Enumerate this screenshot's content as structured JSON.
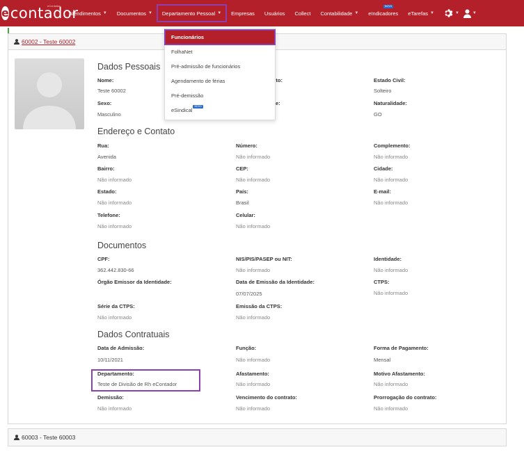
{
  "brand": {
    "name": "contador",
    "tag": "eContador"
  },
  "nav": {
    "items": [
      {
        "label": "Atendimentos",
        "dropdown": true
      },
      {
        "label": "Documentos",
        "dropdown": true
      },
      {
        "label": "Departamento Pessoal",
        "dropdown": true
      },
      {
        "label": "Empresas",
        "dropdown": false
      },
      {
        "label": "Usuários",
        "dropdown": false
      },
      {
        "label": "Collect",
        "dropdown": false
      },
      {
        "label": "Contabilidade",
        "dropdown": true
      },
      {
        "label": "eIndicadores",
        "dropdown": false
      },
      {
        "label": "eTarefas",
        "dropdown": true
      }
    ],
    "new_badge": "NOVO"
  },
  "dropdown": {
    "items": [
      "Funcionários",
      "FolhaNet",
      "Pré-admissão de funcionários",
      "Agendamento de férias",
      "Pré-demissão",
      "eSindical"
    ],
    "badge": "NOVO"
  },
  "employee": {
    "header": "60002 - Teste 60002",
    "sections": {
      "personal": "Dados Pessoais",
      "address": "Endereço e Contato",
      "documents": "Documentos",
      "contract": "Dados Contratuais"
    },
    "fields": {
      "nome_label": "Nome:",
      "nome": "Teste 60002",
      "nascimento_label": "mento:",
      "estado_civil_label": "Estado Civil:",
      "estado_civil": "Solteiro",
      "sexo_label": "Sexo:",
      "sexo": "Masculino",
      "e_label": "e:",
      "naturalidade_label": "Naturalidade:",
      "naturalidade": "GO",
      "rua_label": "Rua:",
      "rua": "Avenida",
      "numero_label": "Número:",
      "numero": "Não informado",
      "complemento_label": "Complemento:",
      "complemento": "Não informado",
      "bairro_label": "Bairro:",
      "bairro": "Não informado",
      "cep_label": "CEP:",
      "cep": "Não informado",
      "cidade_label": "Cidade:",
      "cidade": "Não informado",
      "estado_label": "Estado:",
      "estado": "Não informado",
      "pais_label": "País:",
      "pais": "Brasil",
      "email_label": "E-mail:",
      "email": "Não informado",
      "telefone_label": "Telefone:",
      "telefone": "Não informado",
      "celular_label": "Celular:",
      "celular": "Não informado",
      "cpf_label": "CPF:",
      "cpf": "362.442.830-66",
      "nis_label": "NIS/PIS/PASEP ou NIT:",
      "nis": "Não informado",
      "identidade_label": "Identidade:",
      "identidade": "Não informado",
      "orgao_label": "Órgão Emissor da Identidade:",
      "data_emissao_id_label": "Data de Emissão da Identidade:",
      "data_emissao_id": "07/07/2025",
      "ctps_label": "CTPS:",
      "ctps": "Não informado",
      "serie_ctps_label": "Série da CTPS:",
      "serie_ctps": "Não informado",
      "emissao_ctps_label": "Emissão da CTPS:",
      "emissao_ctps": "Não informado",
      "admissao_label": "Data de Admissão:",
      "admissao": "10/11/2021",
      "funcao_label": "Função:",
      "funcao": "Não informado",
      "forma_pag_label": "Forma de Pagamento:",
      "forma_pag": "Mensal",
      "departamento_label": "Departamento:",
      "departamento": "Teste de Divisão de Rh eContador",
      "afastamento_label": "Afastamento:",
      "afastamento": "Não informado",
      "motivo_afast_label": "Motivo Afastamento:",
      "motivo_afast": "Não informado",
      "demissao_label": "Demissão:",
      "demissao": "Não informado",
      "vencimento_label": "Vencimento do contrato:",
      "vencimento": "Não informado",
      "prorrogacao_label": "Prorrogação do contrato:",
      "prorrogacao": "Não informado"
    }
  },
  "employee2": {
    "header": "60003 - Teste 60003"
  },
  "colors": {
    "brand": "#b3202a",
    "highlight": "#8e3fae",
    "accent_bar": "#44a74a",
    "badge": "#2d6dc9"
  },
  "icons": [
    "person-icon",
    "gear-icon",
    "user-icon",
    "chevron-down-icon"
  ]
}
